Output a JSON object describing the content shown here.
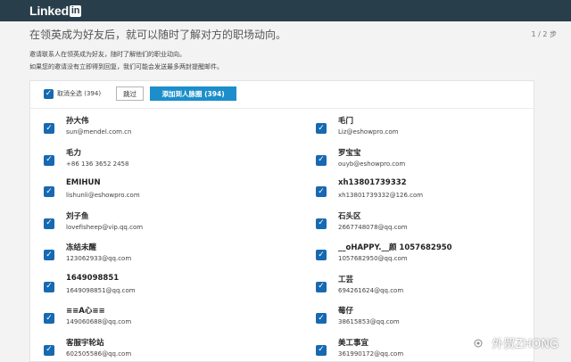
{
  "app": {
    "logo_text": "Linked",
    "logo_badge": "in"
  },
  "header": {
    "headline": "在领英成为好友后，就可以随时了解对方的职场动向。",
    "step": "1 / 2 步",
    "sub1": "邀请联系人在领英成为好友，随时了解他们的职业动向。",
    "sub2": "如果您的邀请没有立即得到回复，我们可能会发送最多两封提醒邮件。"
  },
  "toolbar": {
    "select_all_label": "取消全选 (394)",
    "skip_label": "跳过",
    "add_label": "添加到人脉圈 (394)"
  },
  "contacts_left": [
    {
      "name": "孙大伟",
      "email": "sun@mendel.com.cn"
    },
    {
      "name": "毛力",
      "email": "+86 136 3652 2458"
    },
    {
      "name": "EMIHUN",
      "email": "lishunli@eshowpro.com"
    },
    {
      "name": "刘子鱼",
      "email": "lovefisheep@vip.qq.com"
    },
    {
      "name": "冻结未醒",
      "email": "123062933@qq.com"
    },
    {
      "name": "1649098851",
      "email": "1649098851@qq.com"
    },
    {
      "name": "≡≡A心≡≡",
      "email": "149060688@qq.com"
    },
    {
      "name": "客服宇轮站",
      "email": "602505586@qq.com"
    }
  ],
  "contacts_right": [
    {
      "name": "毛门",
      "email": "Liz@eshowpro.com"
    },
    {
      "name": "罗宝宝",
      "email": "ouyb@eshowpro.com"
    },
    {
      "name": "xh13801739332",
      "email": "xh13801739332@126.com"
    },
    {
      "name": "石头区",
      "email": "2667748078@qq.com"
    },
    {
      "name": "__oHAPPY.__颜 1057682950",
      "email": "1057682950@qq.com"
    },
    {
      "name": "工芸",
      "email": "694261624@qq.com"
    },
    {
      "name": "莓仔",
      "email": "38615853@qq.com"
    },
    {
      "name": "美工事宜",
      "email": "361990172@qq.com"
    }
  ],
  "watermark": {
    "text": "外贸ZHONG"
  },
  "colors": {
    "topbar": "#283e4a",
    "accent": "#1c8ecb",
    "checkbox": "#1769b0"
  },
  "icons": {
    "checkbox": "check-icon",
    "watermark": "wechat-logo-icon"
  }
}
